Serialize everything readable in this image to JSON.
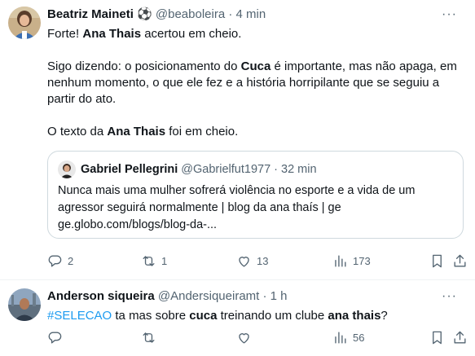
{
  "tweets": [
    {
      "author_name": "Beatriz Maineti",
      "badge": "⚽",
      "handle": "@beaboleira",
      "time": "· 4 min",
      "more_label": "···",
      "paragraphs": [
        [
          {
            "t": "Forte! "
          },
          {
            "t": "Ana Thais",
            "b": true
          },
          {
            "t": " acertou em cheio."
          }
        ],
        [
          {
            "t": "Sigo dizendo: o posicionamento do "
          },
          {
            "t": "Cuca",
            "b": true
          },
          {
            "t": " é importante, mas não apaga, em nenhum momento, o que ele fez e a história horripilante que se seguiu a partir do ato."
          }
        ],
        [
          {
            "t": "O texto da "
          },
          {
            "t": "Ana Thais",
            "b": true
          },
          {
            "t": " foi em cheio."
          }
        ]
      ],
      "quote": {
        "author_name": "Gabriel Pellegrini",
        "handle": "@Gabrielfut1977",
        "time": "· 32 min",
        "line1": "Nunca mais uma mulher sofrerá violência no esporte e a vida de um",
        "line2": "agressor seguirá normalmente | blog da ana thaís | ge",
        "line3": "ge.globo.com/blogs/blog-da-..."
      },
      "actions": {
        "replies": "2",
        "reposts": "1",
        "likes": "13",
        "views": "173"
      }
    },
    {
      "author_name": "Anderson siqueira",
      "handle": "@Andersiqueiramt",
      "time": "· 1 h",
      "more_label": "···",
      "segments": [
        {
          "t": "#SELECAO",
          "link": true
        },
        {
          "t": " ta mas sobre "
        },
        {
          "t": "cuca",
          "b": true
        },
        {
          "t": " treinando um clube "
        },
        {
          "t": "ana thais",
          "b": true
        },
        {
          "t": "?"
        }
      ],
      "actions": {
        "replies": "",
        "reposts": "",
        "likes": "",
        "views": "56"
      }
    }
  ],
  "icons": {
    "reply": "reply-icon",
    "repost": "repost-icon",
    "like": "heart-icon",
    "views": "views-icon",
    "bookmark": "bookmark-icon",
    "share": "share-icon",
    "badge": "soccer-ball-icon"
  },
  "colors": {
    "link": "#1d9bf0",
    "muted": "#536471",
    "text": "#0f1419",
    "border": "#cfd9de"
  }
}
